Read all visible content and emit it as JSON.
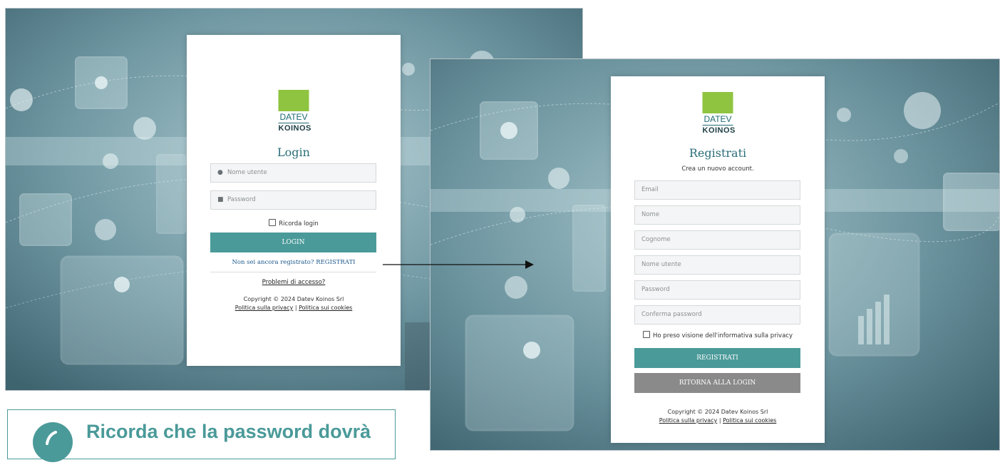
{
  "login": {
    "logo_brand": "DATEV",
    "logo_sub": "KOINOS",
    "title": "Login",
    "username_placeholder": "Nome utente",
    "password_placeholder": "Password",
    "remember_label": "Ricorda login",
    "login_button": "LOGIN",
    "register_link": "Non sei ancora registrato? REGISTRATI",
    "access_problems": "Problemi di accesso?",
    "copyright": "Copyright © 2024 Datev Koinos Srl",
    "privacy_link": "Politica sulla privacy",
    "separator": "|",
    "cookies_link": "Politica sui cookies"
  },
  "register": {
    "logo_brand": "DATEV",
    "logo_sub": "KOINOS",
    "title": "Registrati",
    "subtitle": "Crea un nuovo account.",
    "fields": {
      "email": "Email",
      "nome": "Nome",
      "cognome": "Cognome",
      "nome_utente": "Nome utente",
      "password": "Password",
      "conferma_password": "Conferma password"
    },
    "privacy_check": "Ho preso visione dell'informativa sulla privacy",
    "register_button": "REGISTRATI",
    "back_button": "RITORNA ALLA LOGIN",
    "copyright": "Copyright © 2024 Datev Koinos Srl",
    "privacy_link": "Politica sulla privacy",
    "separator": "|",
    "cookies_link": "Politica sui cookies"
  },
  "tip": {
    "text": "Ricorda che la password dovrà"
  },
  "colors": {
    "accent": "#4a9a99",
    "logo_green": "#8fc440",
    "button_grey": "#8a8a8a",
    "title_teal": "#2a6e78"
  },
  "icons": {
    "user": "user-icon",
    "lock": "lock-icon",
    "arrow": "arrow-right-icon",
    "tip": "info-circle-icon"
  }
}
